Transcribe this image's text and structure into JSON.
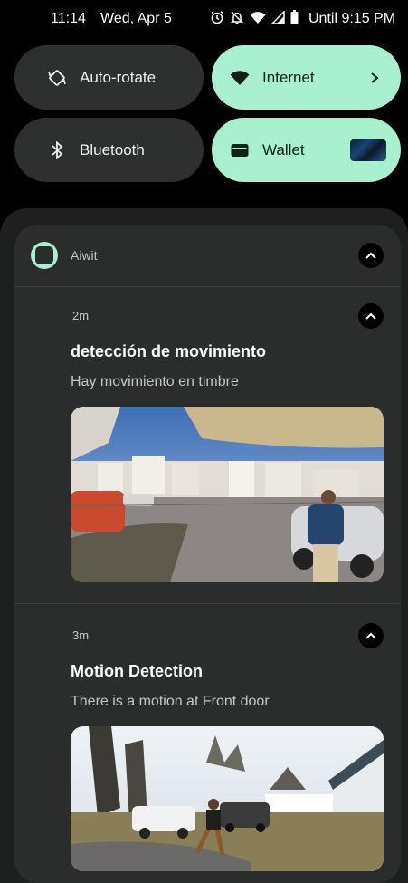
{
  "status_bar": {
    "time": "11:14",
    "date": "Wed, Apr 5",
    "until": "Until 9:15 PM",
    "icons": [
      "alarm-icon",
      "notifications-off-icon",
      "wifi-icon",
      "signal-icon",
      "battery-icon"
    ]
  },
  "tiles": [
    {
      "label": "Auto-rotate",
      "icon": "auto-rotate-icon",
      "active": false
    },
    {
      "label": "Internet",
      "icon": "wifi-icon",
      "active": true
    },
    {
      "label": "Bluetooth",
      "icon": "bluetooth-icon",
      "active": false
    },
    {
      "label": "Wallet",
      "icon": "wallet-icon",
      "active": true
    }
  ],
  "notification_group": {
    "app_name": "Aiwit",
    "notifications": [
      {
        "time": "2m",
        "title": "detección de movimiento",
        "body": "Hay movimiento en timbre",
        "image": "doorbell camera snapshot"
      },
      {
        "time": "3m",
        "title": "Motion Detection",
        "body": "There is a motion at Front door",
        "image": "doorbell camera snapshot"
      }
    ]
  },
  "colors": {
    "tile_active": "#a8f0ce",
    "tile_inactive": "#2e302f",
    "card_bg": "#2a2d2c",
    "shade_bg": "#1d201f"
  }
}
